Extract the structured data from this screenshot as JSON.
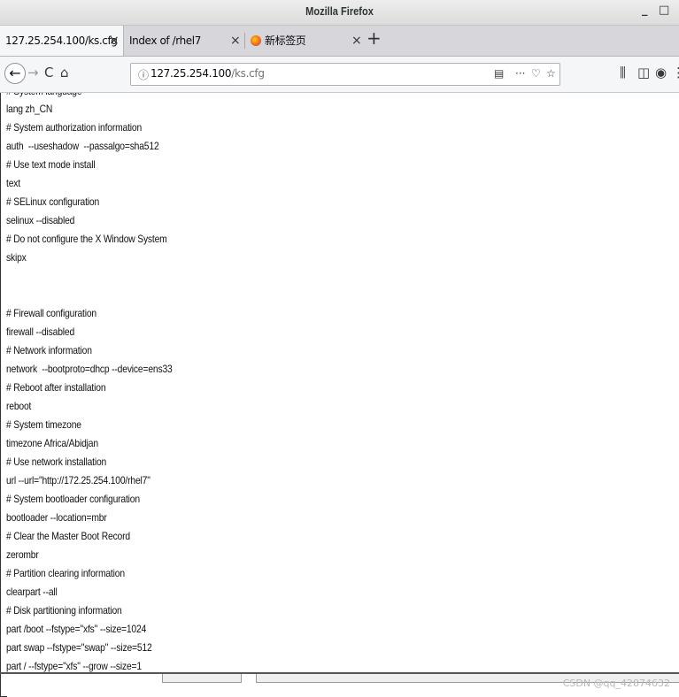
{
  "window": {
    "title": "Mozilla Firefox",
    "minimize": "_",
    "maximize": "□"
  },
  "tabs": [
    {
      "label": "127.25.254.100/ks.cfg",
      "close": "×",
      "active": true
    },
    {
      "label": "Index of /rhel7",
      "close": "×",
      "active": false
    },
    {
      "label": "新标签页",
      "close": "×",
      "active": false
    }
  ],
  "newtab": "+",
  "nav": {
    "back": "←",
    "forward": "→",
    "reload": "C",
    "home": "⌂",
    "url_info_icon": "ⓘ",
    "url_host": "127.25.254.100",
    "url_path": "/ks.cfg",
    "reader_icon": "▤",
    "menu_dots": "···",
    "pocket_icon": "♡",
    "bookmark_icon": "☆",
    "library_icon": "⫼",
    "sidebar_icon": "◫",
    "extension_icon": "◉",
    "menu_icon": "⋮"
  },
  "content": {
    "lines": [
      "# System language",
      "lang zh_CN",
      "# System authorization information",
      "auth  --useshadow  --passalgo=sha512",
      "# Use text mode install",
      "text",
      "# SELinux configuration",
      "selinux --disabled",
      "# Do not configure the X Window System",
      "skipx",
      "",
      "",
      "# Firewall configuration",
      "firewall --disabled",
      "# Network information",
      "network  --bootproto=dhcp --device=ens33",
      "# Reboot after installation",
      "reboot",
      "# System timezone",
      "timezone Africa/Abidjan",
      "# Use network installation",
      "url --url=\"http://172.25.254.100/rhel7\"",
      "# System bootloader configuration",
      "bootloader --location=mbr",
      "# Clear the Master Boot Record",
      "zerombr",
      "# Partition clearing information",
      "clearpart --all",
      "# Disk partitioning information",
      "part /boot --fstype=\"xfs\" --size=1024",
      "part swap --fstype=\"swap\" --size=512",
      "part / --fstype=\"xfs\" --grow --size=1"
    ]
  },
  "watermark": "CSDN @qq_42874632"
}
